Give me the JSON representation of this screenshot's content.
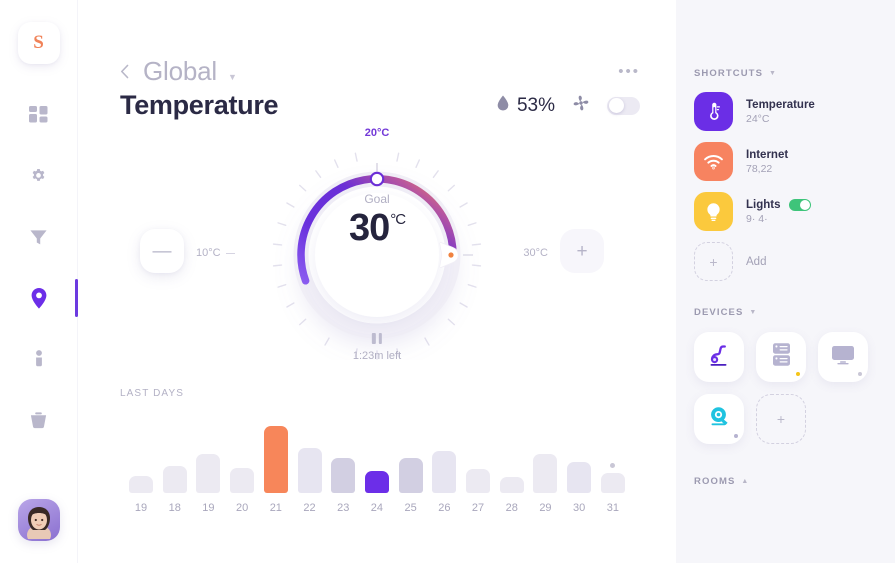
{
  "app": {
    "logo_letter": "S",
    "logo_color": "#f08258"
  },
  "rail": {
    "items": [
      {
        "name": "dashboard-grid",
        "label": "Dashboard",
        "active": false
      },
      {
        "name": "settings-gear",
        "label": "Settings",
        "active": false
      },
      {
        "name": "filter-funnel",
        "label": "Filter",
        "active": false
      },
      {
        "name": "location-pin",
        "label": "Location",
        "active": true
      },
      {
        "name": "person",
        "label": "Profile",
        "active": false
      },
      {
        "name": "trash",
        "label": "Trash",
        "active": false
      }
    ],
    "active_color": "#6c3ae0"
  },
  "header": {
    "breadcrumb": "Global",
    "title": "Temperature",
    "menu_dots": "•••",
    "humidity_value": "53%",
    "fan_toggle_on": false
  },
  "dial": {
    "top_label": "20°C",
    "min_label": "10°C",
    "max_label": "30°C",
    "goal_caption": "Goal",
    "goal_value": "30",
    "goal_unit": "°C",
    "timer_text": "1:23m left",
    "minus_label": "—",
    "plus_label": "+",
    "arc_start_color": "#7c46e8",
    "arc_mid_color": "#5b2fd4",
    "arc_end_color": "#f0825a"
  },
  "chart_data": {
    "type": "bar",
    "title": "LAST DAYS",
    "xlabel": "",
    "ylabel": "",
    "categories": [
      "19",
      "18",
      "19",
      "20",
      "21",
      "22",
      "23",
      "24",
      "25",
      "26",
      "27",
      "28",
      "29",
      "30",
      "31"
    ],
    "values": [
      18,
      29,
      42,
      27,
      72,
      49,
      38,
      24,
      38,
      45,
      26,
      17,
      42,
      33,
      22
    ],
    "ylim": [
      0,
      80
    ],
    "grid": false,
    "bar_colors": [
      "#eceaf2",
      "#eceaf2",
      "#eceaf2",
      "#eceaf2",
      "#f7865a",
      "#e7e5f1",
      "#d2cfe2",
      "#6c2ee8",
      "#d2cfe2",
      "#e7e5f1",
      "#eceaf2",
      "#eceaf2",
      "#eceaf2",
      "#e7e5f1",
      "#eceaf2"
    ],
    "marker_dot_index": 14,
    "marker_dot_color": "#c9c7d6"
  },
  "right": {
    "shortcuts_header": "SHORTCUTS",
    "shortcuts": [
      {
        "icon": "thermometer-icon",
        "title": "Temperature",
        "sub": "24°C",
        "color": "#6b2ee6",
        "has_toggle": false
      },
      {
        "icon": "wifi-icon",
        "title": "Internet",
        "sub": "78,22",
        "color": "#f78360",
        "has_toggle": false
      },
      {
        "icon": "lightbulb-icon",
        "title": "Lights",
        "sub": "9·  4·",
        "color": "#fbc93d",
        "has_toggle": true,
        "toggle_on": true,
        "toggle_color": "#3ec47a"
      }
    ],
    "add_label": "Add",
    "add_symbol": "+",
    "devices_header": "DEVICES",
    "devices": [
      {
        "icon": "vacuum-icon",
        "color": "#6b2ee6",
        "dot_color": ""
      },
      {
        "icon": "washing-machine-icon",
        "color": "#b6b3d0",
        "dot_color": "#f5c518"
      },
      {
        "icon": "tv-icon",
        "color": "#b6b3d0",
        "dot_color": "#c9c7d6"
      },
      {
        "icon": "camera-icon",
        "color": "#1fc3e0",
        "dot_color": "#b6b3d0"
      }
    ],
    "device_add_symbol": "+",
    "rooms_header": "ROOMS"
  }
}
